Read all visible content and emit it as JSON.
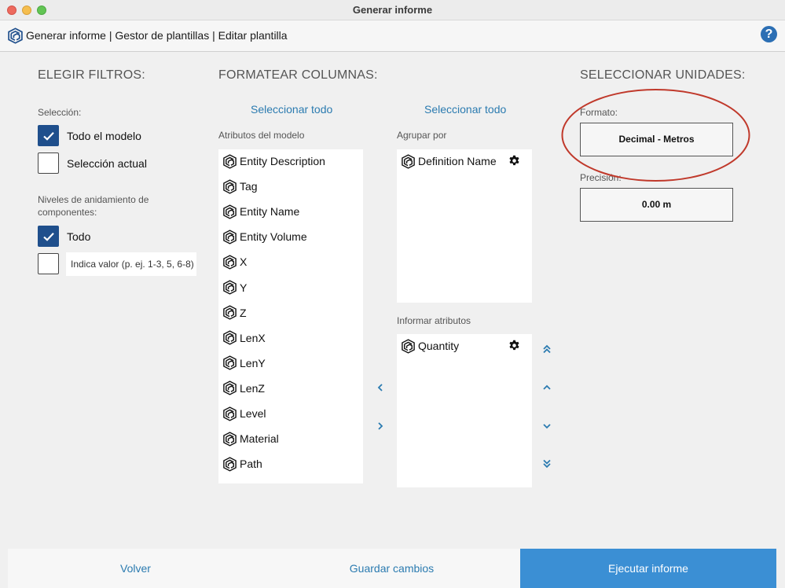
{
  "window": {
    "title": "Generar informe"
  },
  "nav": {
    "crumbs": [
      "Generar informe",
      "Gestor de plantillas",
      "Editar plantilla"
    ],
    "separator": " | ",
    "help": "?"
  },
  "filters": {
    "title": "ELEGIR FILTROS:",
    "selection_label": "Selección:",
    "options": [
      {
        "label": "Todo el modelo",
        "checked": true
      },
      {
        "label": "Selección actual",
        "checked": false
      }
    ],
    "nesting_label_line1": "Niveles de anidamiento de",
    "nesting_label_line2": "componentes:",
    "nesting_all": {
      "label": "Todo",
      "checked": true
    },
    "nesting_input": {
      "checked": false,
      "placeholder": "Indica valor (p. ej. 1-3, 5, 6-8)"
    }
  },
  "columns": {
    "title": "FORMATEAR COLUMNAS:",
    "select_all_left": "Seleccionar todo",
    "select_all_right": "Seleccionar todo",
    "model_attrs_label": "Atributos del modelo",
    "model_attrs": [
      "Entity Description",
      "Tag",
      "Entity Name",
      "Entity Volume",
      "X",
      "Y",
      "Z",
      "LenX",
      "LenY",
      "LenZ",
      "Level",
      "Material",
      "Path"
    ],
    "group_by_label": "Agrupar por",
    "group_by": [
      "Definition Name"
    ],
    "report_attrs_label": "Informar atributos",
    "report_attrs": [
      "Quantity"
    ]
  },
  "units": {
    "title": "SELECCIONAR UNIDADES:",
    "format_label": "Formato:",
    "format_value": "Decimal - Metros",
    "precision_label": "Precisión:",
    "precision_value": "0.00 m"
  },
  "footer": {
    "back": "Volver",
    "save": "Guardar cambios",
    "run": "Ejecutar informe"
  },
  "colors": {
    "accent": "#2b7bb0",
    "checkbox": "#1f4f8c",
    "run_button": "#3b8fd4",
    "annotation": "#c0392b"
  }
}
